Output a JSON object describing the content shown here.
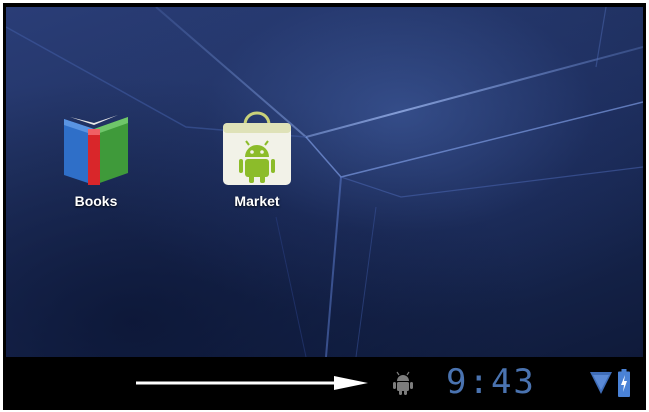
{
  "home_screen": {
    "apps": [
      {
        "label": "Books",
        "icon": "books-icon"
      },
      {
        "label": "Market",
        "icon": "market-icon"
      }
    ]
  },
  "system_bar": {
    "clock": "9:43",
    "notification_icon": "android-icon",
    "status_icons": [
      "wifi-icon",
      "battery-charging-icon"
    ],
    "clock_color": "#4a73b0"
  },
  "annotation": {
    "arrow": "arrow-right-icon",
    "arrow_color": "#ffffff"
  }
}
